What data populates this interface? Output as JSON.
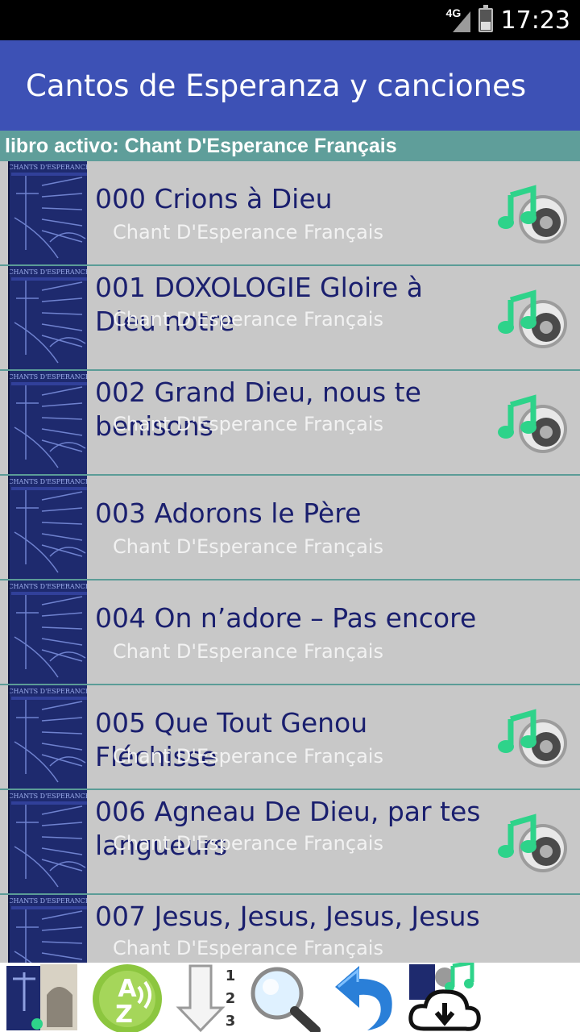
{
  "status_bar": {
    "network": "4G",
    "time": "17:23",
    "icons": [
      "signal-icon",
      "battery-icon"
    ]
  },
  "app_bar": {
    "title": "Cantos de Esperanza y canciones"
  },
  "active_book": {
    "label": "libro activo: Chant D'Esperance Français"
  },
  "songs": [
    {
      "title": "000 Crions à Dieu",
      "book": "Chant D'Esperance Français",
      "has_audio": true
    },
    {
      "title": "001 DOXOLOGIE Gloire à Dieu notre",
      "book": "Chant D'Esperance Français",
      "has_audio": true
    },
    {
      "title": "002 Grand Dieu, nous te benisons",
      "book": "Chant D'Esperance Français",
      "has_audio": true
    },
    {
      "title": "003 Adorons le Père",
      "book": "Chant D'Esperance Français",
      "has_audio": false
    },
    {
      "title": "004 On n’adore – Pas encore",
      "book": "Chant D'Esperance Français",
      "has_audio": false
    },
    {
      "title": "005 Que Tout Genou Fléchisse",
      "book": "Chant D'Esperance Français",
      "has_audio": true
    },
    {
      "title": "006 Agneau De Dieu, par tes langueurs",
      "book": "Chant D'Esperance Français",
      "has_audio": true
    },
    {
      "title": "007 Jesus, Jesus, Jesus, Jesus",
      "book": "Chant D'Esperance Français",
      "has_audio": false
    }
  ],
  "cover_text": "CHANTS D'ESPERANCE",
  "bottom_bar": {
    "items": [
      {
        "name": "books-icon"
      },
      {
        "name": "sort-alphabetical-icon",
        "label": "AZ"
      },
      {
        "name": "sort-numeric-icon",
        "labels": [
          "1",
          "2",
          "3"
        ]
      },
      {
        "name": "search-icon"
      },
      {
        "name": "undo-icon"
      },
      {
        "name": "download-audio-icon"
      }
    ]
  },
  "colors": {
    "app_bar": "#3d51b5",
    "active_book_bar": "#5f9e9a",
    "list_bg": "#c8c8c8",
    "title_text": "#1a1f6e",
    "music_note": "#2ed38a"
  }
}
